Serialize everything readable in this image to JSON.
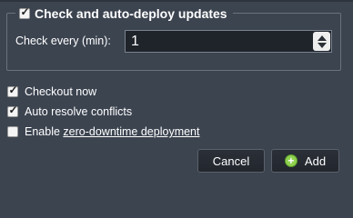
{
  "auto_deploy": {
    "legend_label": "Check and auto-deploy updates",
    "checked": true,
    "frequency_label": "Check every (min):",
    "frequency_value": "1"
  },
  "options": {
    "checkout_now": {
      "label": "Checkout now",
      "checked": true
    },
    "auto_resolve": {
      "label": "Auto resolve conflicts",
      "checked": true
    },
    "zero_downtime": {
      "label_prefix": "Enable ",
      "label_link": "zero-downtime deployment",
      "checked": false
    }
  },
  "buttons": {
    "cancel_label": "Cancel",
    "add_label": "Add",
    "add_icon": "plus-circle-icon"
  },
  "colors": {
    "background": "#3c4450",
    "add_icon": "#8fd14f"
  }
}
